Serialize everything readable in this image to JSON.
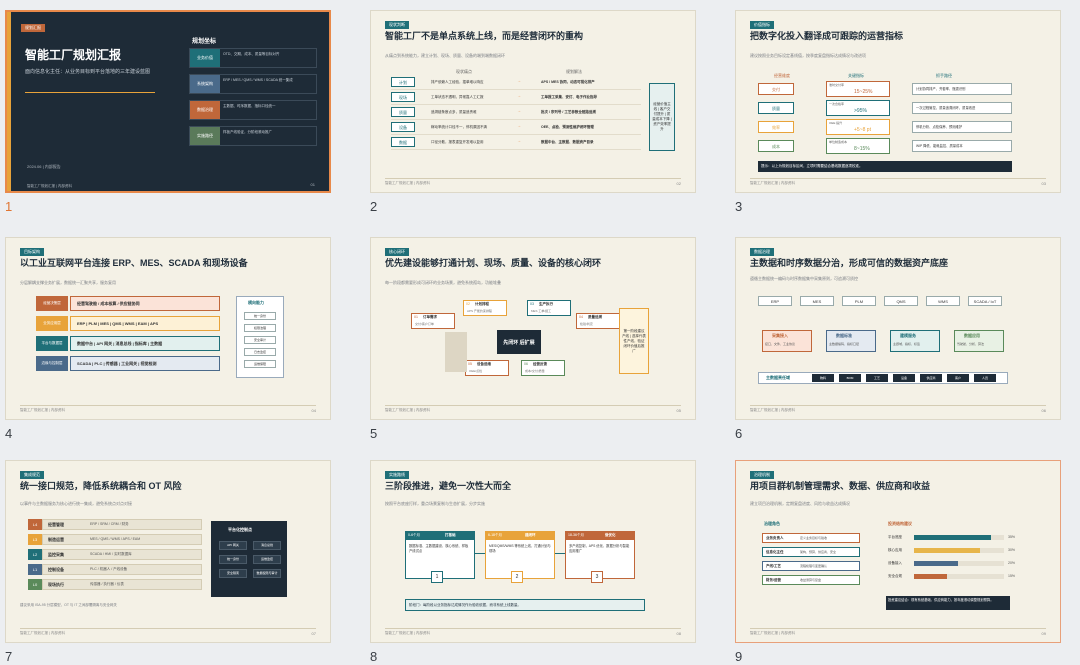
{
  "slides": [
    {
      "num": "1",
      "tag": "规划汇报",
      "title": "智能工厂规划汇报",
      "subtitle": "面向信息化主任：从业务目标到平台落地的三年建设蓝图",
      "date": "2024.06 | 内部报告",
      "foot": "智能工厂规划汇报 | 内部资料",
      "page": "01",
      "side_title": "规划坐标",
      "side": [
        {
          "label": "业务价值",
          "text": "OTD、交期、成本、质量等目标对齐"
        },
        {
          "label": "系统架构",
          "text": "ERP / MES / QMS / WMS / SCADA 统一集成"
        },
        {
          "label": "数据治理",
          "text": "主数据、时序数据、指标口径统一"
        },
        {
          "label": "实施路径",
          "text": "样板产线验证，分阶段滚动推广"
        }
      ]
    },
    {
      "num": "2",
      "tag": "现状判断",
      "title": "智能工厂不是单点系统上线，而是经营闭环的重构",
      "subtitle": "从痛点到系统能力，建立计划、现场、质量、设备的端到端数据闭环",
      "col1": "现状痛点",
      "col2": "规划解法",
      "rows": [
        {
          "k": "计划",
          "a": "排产依赖人工经验，插单难以响应",
          "b": "APS / MES 协同，动态可视化排产"
        },
        {
          "k": "现场",
          "a": "工单状态不透明，异常靠人工汇报",
          "b": "工单报工采集、安灯、电子作业指导"
        },
        {
          "k": "质量",
          "a": "追溯链条断点多，质量追责难",
          "b": "批次 / 序列号 / 工艺参数全链路追溯"
        },
        {
          "k": "设备",
          "a": "稼动率统计口径不一，停机原因不清",
          "b": "OEE、点检、预测性维护闭环管理"
        },
        {
          "k": "数据",
          "a": "口径分散，报表重复开发难以复用",
          "b": "数据中台、主数据、数据资产目录"
        }
      ],
      "side": "经营价值主线 | 客户交付提升 | 质量成本下降 | 资产效率提升",
      "page": "02"
    },
    {
      "num": "3",
      "tag": "价值指标",
      "title": "把数字化投入翻译成可跟踪的运营指标",
      "subtitle": "建议按照业务目标设定基线值，按季度复盘指标达成情况与改进项",
      "col1": "经营维度",
      "col2": "关键指标",
      "col3": "抓手路径",
      "rows": [
        {
          "k": "交付",
          "v": "15~25%",
          "note": "准时交付率",
          "c": "计划协同排产、齐套率、瓶颈识别"
        },
        {
          "k": "质量",
          "v": ">95%",
          "note": "一次合格率",
          "c": "一次过程管控，质量追溯闭环，质量改进"
        },
        {
          "k": "效率",
          "v": "+5~8 pt",
          "note": "OEE 提升",
          "c": "停机分析、点检保养、预测维护"
        },
        {
          "k": "成本",
          "v": "8~15%",
          "note": "单位制造成本",
          "c": "WIP 降低、能耗监控、质量成本"
        }
      ],
      "note": "提示：以上为规划目标区间，立项时需要结合基线数据逐项校准。",
      "page": "03"
    },
    {
      "num": "4",
      "tag": "目标架构",
      "title": "以工业互联网平台连接 ERP、MES、SCADA 和现场设备",
      "subtitle": "分层解耦支撑业务扩展，数据统一汇聚共享，服务复用",
      "layers": [
        {
          "k": "经营决策层",
          "v": "经营驾驶舱 / 成本核算 / 供应链协同"
        },
        {
          "k": "业务应用层",
          "v": "ERP | PLM | MES | QMS | WMS | EAM | APS"
        },
        {
          "k": "平台与数据层",
          "v": "数据中台 | API 网关 | 消息总线 | 指标库 | 主数据"
        },
        {
          "k": "边缘与控制层",
          "v": "SCADA | PLC | 传感器 | 工业网关 | 视觉检测"
        }
      ],
      "side_title": "横向能力",
      "side_items": [
        "统一身份",
        "权限治理",
        "安全审计",
        "日志监控",
        "运维保障"
      ],
      "page": "04"
    },
    {
      "num": "5",
      "tag": "核心闭环",
      "title": "优先建设能够打通计划、现场、质量、设备的核心闭环",
      "subtitle": "每一阶段都需要形成可闭环的业务场景，避免系统孤岛，功能堆叠",
      "nodes": [
        {
          "n": "01",
          "k": "订单需求",
          "d": "交付/客户订单"
        },
        {
          "n": "02",
          "k": "计划排程",
          "d": "APS 产能约束排程"
        },
        {
          "n": "03",
          "k": "生产执行",
          "d": "MES 工单/报工"
        },
        {
          "n": "04",
          "k": "质量追溯",
          "d": "检验/判定"
        },
        {
          "n": "05",
          "k": "设备运维",
          "d": "OEE/点检"
        },
        {
          "n": "06",
          "k": "经营反馈",
          "d": "成本/交付/质量"
        }
      ],
      "center": "先闭环 后扩展",
      "side": "第一阶段建议产线 | 选择代表性产线，验证闭环价值后推广",
      "page": "05"
    },
    {
      "num": "6",
      "tag": "数据治理",
      "title": "主数据和时序数据分治，形成可信的数据资产底座",
      "subtitle": "遵循主数据统一编码与时序数据集中采集原则，可追溯可质控",
      "sources": [
        "ERP",
        "MES",
        "PLM",
        "QMS",
        "WMS",
        "SCADA / IoT"
      ],
      "flow": [
        {
          "k": "采集接入",
          "d": "接口、文件、工业协议"
        },
        {
          "k": "数据标准",
          "d": "主数据编码、指标口径"
        },
        {
          "k": "建模服务",
          "d": "主题域、指标、标签"
        },
        {
          "k": "数据应用",
          "d": "驾驶舱、分析、算法"
        }
      ],
      "bar_label": "主数据责任域",
      "chips": [
        "物料",
        "BOM",
        "工艺",
        "设备",
        "供应商",
        "客户",
        "人员"
      ],
      "page": "06"
    },
    {
      "num": "7",
      "tag": "集成规范",
      "title": "统一接口规范，降低系统耦合和 OT 风险",
      "subtitle": "以事件与主数据服务为核心进行统一集成，避免系统点对点对接",
      "levels": [
        {
          "k": "L4",
          "n": "经营管理",
          "d": "ERP / SRM / CRM / 财务"
        },
        {
          "k": "L3",
          "n": "制造运营",
          "d": "MES / QMS / WMS / APS / EAM"
        },
        {
          "k": "L2",
          "n": "监控采集",
          "d": "SCADA / HMI / 实时数据库"
        },
        {
          "k": "L1",
          "n": "控制设备",
          "d": "PLC / 机器人 / 产线设备"
        },
        {
          "k": "L0",
          "n": "现场执行",
          "d": "传感器 / 执行器 / 仪表"
        }
      ],
      "panel_title": "平台化控制点",
      "panel": [
        "API 网关",
        "消息总线",
        "统一身份",
        "运维监控",
        "安全隔离",
        "数据权限与审计"
      ],
      "note": "建议采用 ISA-95 分层模型，OT 与 IT 之间部署隔离与安全网关",
      "page": "07"
    },
    {
      "num": "8",
      "tag": "实施路线",
      "title": "三阶段推进，避免一次性大而全",
      "subtitle": "按照平台底座打样，重点场景复制与生态扩展，分步实施",
      "phases": [
        {
          "t": "0-6个月",
          "n": "打基础",
          "d": "数据标准、主数据建设、核心系统、样板产线试点",
          "i": "1"
        },
        {
          "t": "6-18个月",
          "n": "建闭环",
          "d": "MES/QMS/WMS 等系统上线，打通计划与现场",
          "i": "2"
        },
        {
          "t": "18-36个月",
          "n": "做优化",
          "d": "多产线复制，APS 优化、数据分析与智能应用推广",
          "i": "3"
        }
      ],
      "gate": "阶段门：每阶段以业务指标达成情况作为验收依据，而非系统上线数量。",
      "page": "08"
    },
    {
      "num": "9",
      "tag": "治理机制",
      "title": "用项目群机制管理需求、数据、供应商和收益",
      "subtitle": "建立项目治理机制，定期复盘进度、风险与收益达成情况",
      "roles_title": "治理角色",
      "roles": [
        {
          "k": "业务负责人",
          "d": "定义业务目标与验收"
        },
        {
          "k": "信息化主任",
          "d": "架构、预算、供应商、安全"
        },
        {
          "k": "产线/工艺",
          "d": "流程梳理与变更确认"
        },
        {
          "k": "财务/运营",
          "d": "收益测算与复盘"
        }
      ],
      "bars_title": "投资结构建议",
      "bars": [
        {
          "k": "平台底座",
          "v": 0.35,
          "p": "35%",
          "c": "#1f6f78"
        },
        {
          "k": "核心应用",
          "v": 0.3,
          "p": "30%",
          "c": "#e7b54a"
        },
        {
          "k": "设备接入",
          "v": 0.2,
          "p": "20%",
          "c": "#4a6a8a"
        },
        {
          "k": "安全合规",
          "v": 0.15,
          "p": "15%",
          "c": "#c0673a"
        }
      ],
      "note": "投资建议结合：现有系统基础、供应商能力，按年度滚动调整规划预算。",
      "page": "09"
    }
  ],
  "footer": "智能工厂规划汇报 | 内部资料"
}
